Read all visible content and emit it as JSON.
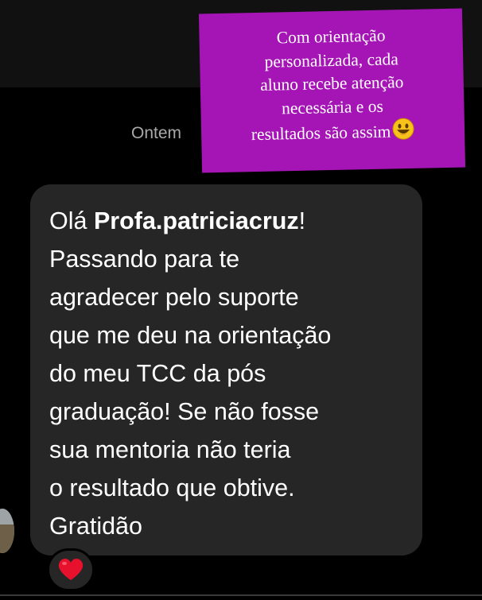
{
  "thread": {
    "timestamp": "Ontem"
  },
  "caption": {
    "lines": [
      "Com orientação",
      "personalizada, cada",
      "aluno recebe atenção",
      "necessária  e os",
      "resultados são assim"
    ],
    "emoji": "smiley-icon",
    "background": "#a514b4"
  },
  "message": {
    "greeting": "Olá ",
    "username": "Profa.patriciacruz",
    "greeting_end": "!",
    "lines": [
      "Passando para te",
      "agradecer pelo suporte",
      "que me deu na orientação",
      "do meu TCC da pós",
      "graduação! Se não fosse",
      "sua mentoria não teria",
      "o resultado que obtive.",
      "Gratidão"
    ],
    "bubble_color": "#262626"
  },
  "reaction": {
    "icon": "heart-icon",
    "color": "#e8112d"
  }
}
